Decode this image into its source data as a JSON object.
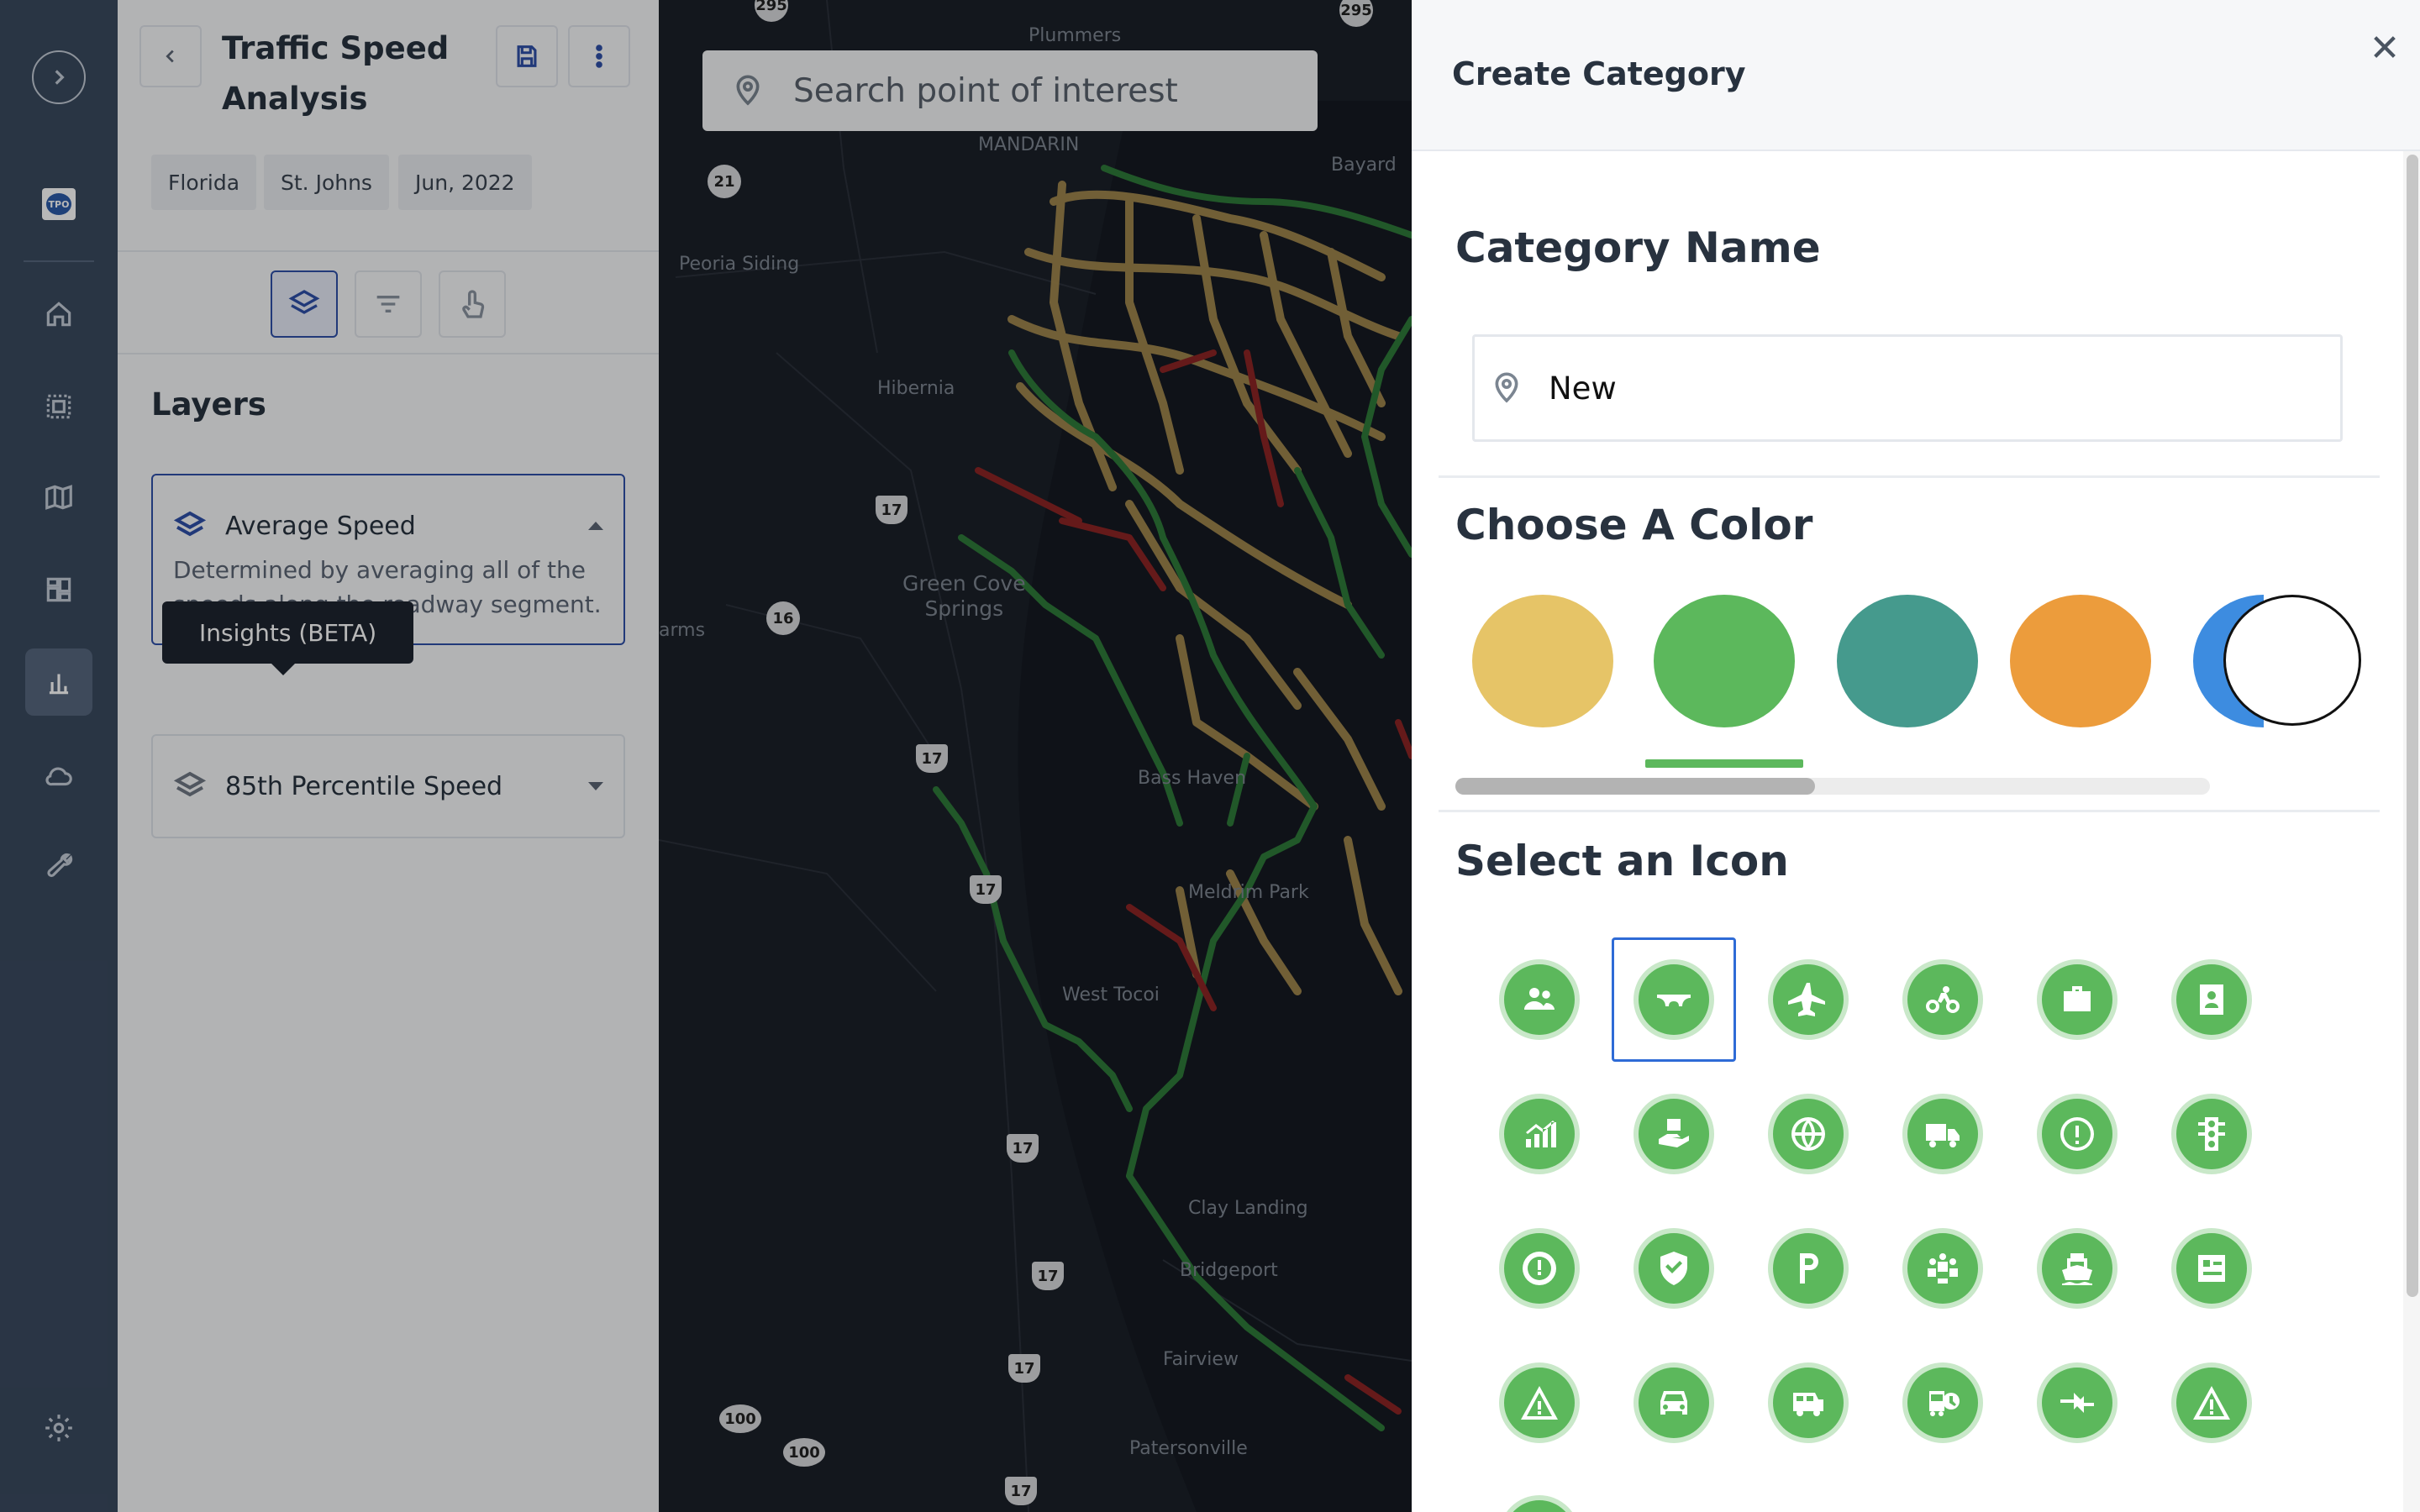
{
  "nav_rail": {
    "items": [
      {
        "name": "home-icon"
      },
      {
        "name": "select-area-icon"
      },
      {
        "name": "map-icon"
      },
      {
        "name": "dashboard-icon"
      },
      {
        "name": "bar-chart-icon",
        "active": true
      },
      {
        "name": "cloud-icon"
      },
      {
        "name": "wrench-icon"
      },
      {
        "name": "gear-icon"
      }
    ],
    "logo_text": "TPO"
  },
  "analysis_panel": {
    "title": "Traffic Speed Analysis",
    "chips": [
      "Florida",
      "St. Johns",
      "Jun, 2022"
    ],
    "layers_heading": "Layers",
    "layers": [
      {
        "name": "Average Speed",
        "description": "Determined by averaging all of the speeds along the roadway segment.",
        "expanded": true
      },
      {
        "name": "85th Percentile Speed",
        "expanded": false
      }
    ],
    "tooltip": "Insights (BETA)"
  },
  "map": {
    "search_placeholder": "Search point of interest",
    "labels": {
      "plummers": "Plummers",
      "mandarin": "MANDARIN",
      "bayard": "Bayard",
      "peoria_siding": "Peoria Siding",
      "hibernia": "Hibernia",
      "green_cove_springs": "Green Cove\nSprings",
      "arms": "arms",
      "basshaven": "Bass Haven",
      "meldrim_park": "Meldrim Park",
      "west_tocoi": "West Tocoi",
      "clay_landing": "Clay Landing",
      "bridgeport": "Bridgeport",
      "fairview": "Fairview",
      "patersonville": "Patersonville"
    },
    "shields": [
      "295",
      "295",
      "21",
      "17",
      "16",
      "17",
      "17",
      "17",
      "17",
      "17",
      "100",
      "100",
      "17"
    ]
  },
  "drawer": {
    "title": "Create Category",
    "category_name_heading": "Category Name",
    "category_name_value": "New",
    "choose_color_heading": "Choose A Color",
    "colors": [
      "#e6c467",
      "#5cb85c",
      "#459a8d",
      "#ec9c3c",
      "#3d8ce0"
    ],
    "selected_color": "#5cb85c",
    "select_icon_heading": "Select an Icon",
    "icons": [
      "people-icon",
      "bridge-icon",
      "airplane-icon",
      "bicycle-icon",
      "briefcase-icon",
      "contact-card-icon",
      "chart-growth-icon",
      "hand-box-icon",
      "globe-icon",
      "truck-icon",
      "alert-circle-icon",
      "traffic-light-icon",
      "alert-ring-icon",
      "shield-check-icon",
      "parking-icon",
      "community-icon",
      "ferry-icon",
      "id-card-icon",
      "warning-triangle-icon",
      "car-front-icon",
      "bus-icon",
      "bus-clock-icon",
      "merge-arrows-icon",
      "road-warning-icon"
    ],
    "selected_icon": "bridge-icon"
  }
}
